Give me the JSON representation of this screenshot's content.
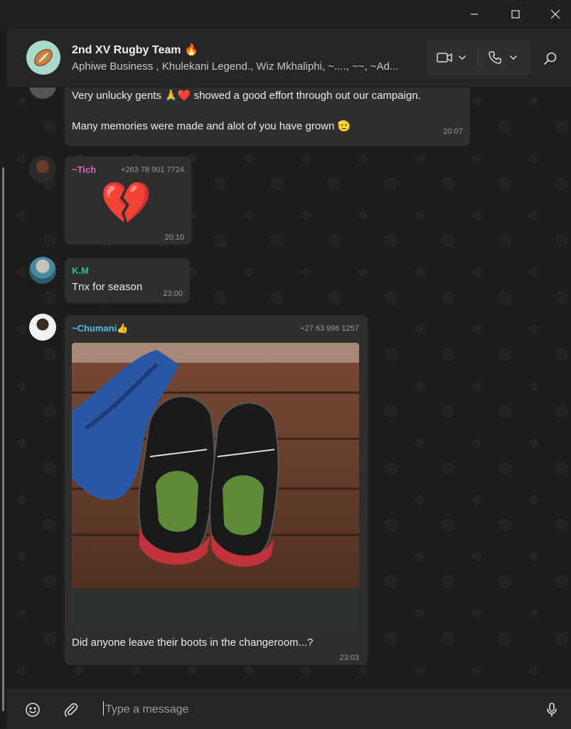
{
  "window": {
    "minimize_icon": "minimize-icon",
    "maximize_icon": "maximize-icon",
    "close_icon": "close-icon"
  },
  "header": {
    "title": "2nd XV Rugby Team 🔥",
    "members": "Aphiwe Business , Khulekani Legend., Wiz Mkhaliphi, ~...., ~~, ~Ad...",
    "avatar_icon": "rugby-ball-icon",
    "video_call_icon": "video-camera-icon",
    "voice_call_icon": "phone-icon",
    "search_icon": "search-icon"
  },
  "messages": [
    {
      "lines": [
        "Very unlucky gents 🙏❤️ showed a good effort through out our campaign.",
        "Many memories were made and alot of you have grown 🫡"
      ],
      "time": "20:07"
    },
    {
      "sender": "~Tich",
      "phone": "+263 78 901 7724",
      "emoji": "💔",
      "time": "20:10",
      "sender_color": "#d368c8"
    },
    {
      "sender": "K.M",
      "text": "Tnx for season",
      "time": "23:00",
      "sender_color": "#25c29a"
    },
    {
      "sender": "~Chumani👍",
      "phone": "+27 63 996 1257",
      "caption": "Did anyone leave their boots in the changeroom...?",
      "time": "23:03",
      "sender_color": "#53bdeb"
    }
  ],
  "composer": {
    "placeholder": "Type a message",
    "emoji_icon": "emoji-icon",
    "attach_icon": "paperclip-icon",
    "mic_icon": "microphone-icon"
  }
}
